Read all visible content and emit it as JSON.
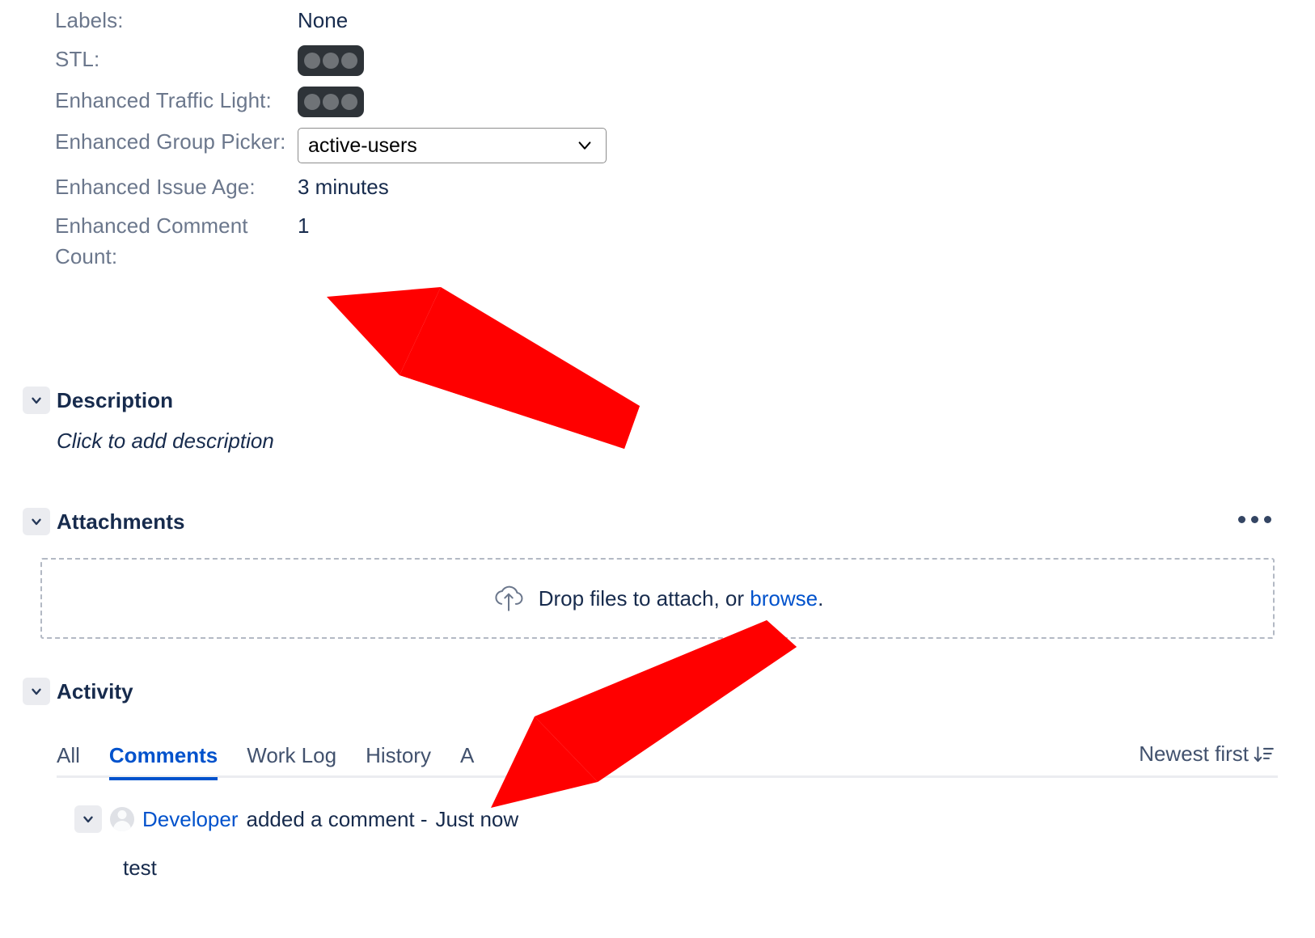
{
  "fields": [
    {
      "label": "Labels:",
      "value": "None",
      "type": "text"
    },
    {
      "label": "STL:",
      "value": "",
      "type": "traffic-light"
    },
    {
      "label": "Enhanced Traffic Light:",
      "value": "",
      "type": "traffic-light"
    },
    {
      "label": "Enhanced Group Picker:",
      "value": "active-users",
      "type": "select"
    },
    {
      "label": "Enhanced Issue Age:",
      "value": "3 minutes",
      "type": "text"
    },
    {
      "label": "Enhanced Comment Count:",
      "value": "1",
      "type": "text"
    }
  ],
  "group_picker": {
    "selected": "active-users",
    "options": [
      "active-users"
    ]
  },
  "description": {
    "title": "Description",
    "placeholder": "Click to add description",
    "chevron_icon": "chevron-down-icon"
  },
  "attachments": {
    "title": "Attachments",
    "more_icon": "more-options-icon",
    "dropzone": {
      "upload_icon": "cloud-upload-icon",
      "text_before": "Drop files to attach, or ",
      "link_text": "browse",
      "text_after": "."
    }
  },
  "activity": {
    "title": "Activity",
    "tabs": [
      {
        "label": "All",
        "active": false
      },
      {
        "label": "Comments",
        "active": true
      },
      {
        "label": "Work Log",
        "active": false
      },
      {
        "label": "History",
        "active": false
      },
      {
        "label": "A",
        "active": false
      }
    ],
    "sort": {
      "label": "Newest first",
      "icon": "sort-descending-icon"
    },
    "comment": {
      "chevron_icon": "chevron-down-icon",
      "avatar_icon": "user-avatar-icon",
      "author": "Developer",
      "action": " added a comment - ",
      "timestamp": "Just now",
      "body": "test"
    }
  },
  "annotations": {
    "arrow_color": "#FF0000",
    "arrows": [
      {
        "name": "arrow-to-enhanced-comment-count"
      },
      {
        "name": "arrow-to-comment-entry"
      }
    ]
  },
  "colors": {
    "label": "#6B778C",
    "value": "#172B4D",
    "link": "#0052CC",
    "accent": "#0052CC",
    "rail": "#EBECF0",
    "traffic_light_bg": "#2E3338",
    "traffic_light_lamp": "#6F7377"
  }
}
